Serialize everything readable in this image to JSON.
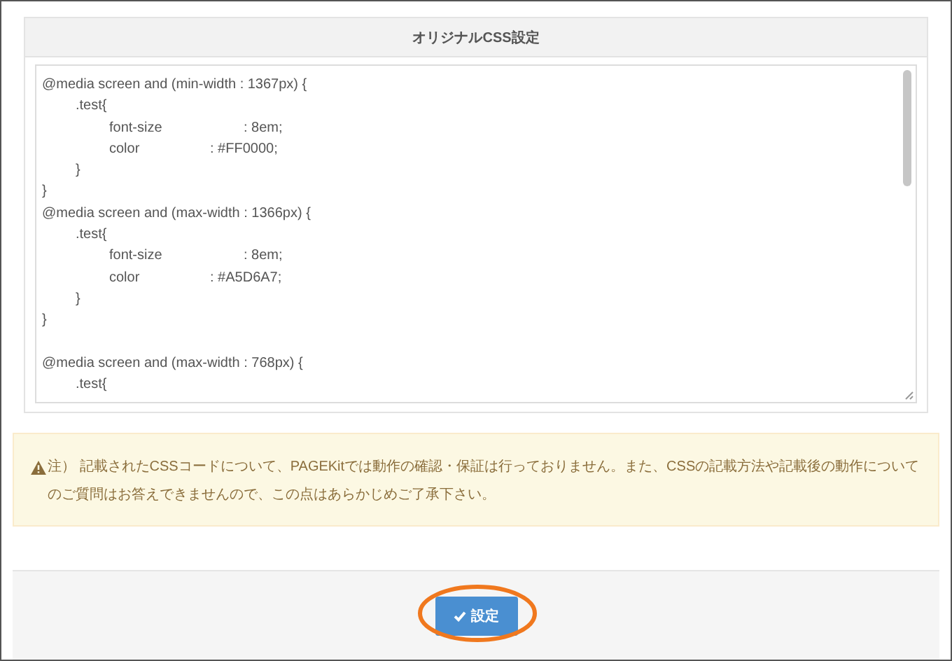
{
  "panel": {
    "title": "オリジナルCSS設定",
    "code_blocks": [
      [
        "@media screen and (min-width : 1367px) {",
        "\t.test{",
        "\t\tfont-size\t\t\t: 8em;",
        "\t\tcolor\t\t\t: #FF0000;",
        "\t}",
        "}",
        "@media screen and (max-width : 1366px) {",
        "\t.test{",
        "\t\tfont-size\t\t\t: 8em;",
        "\t\tcolor\t\t\t: #A5D6A7;",
        "\t}",
        "}"
      ],
      [
        "@media screen and (max-width : 768px) {",
        "\t.test{"
      ]
    ]
  },
  "notice": {
    "text": "注） 記載されたCSSコードについて、PAGEKitでは動作の確認・保証は行っておりません。また、CSSの記載方法や記載後の動作についてのご質問はお答えできませんので、この点はあらかじめご了承下さい。"
  },
  "footer": {
    "button": {
      "label": "設定"
    }
  }
}
